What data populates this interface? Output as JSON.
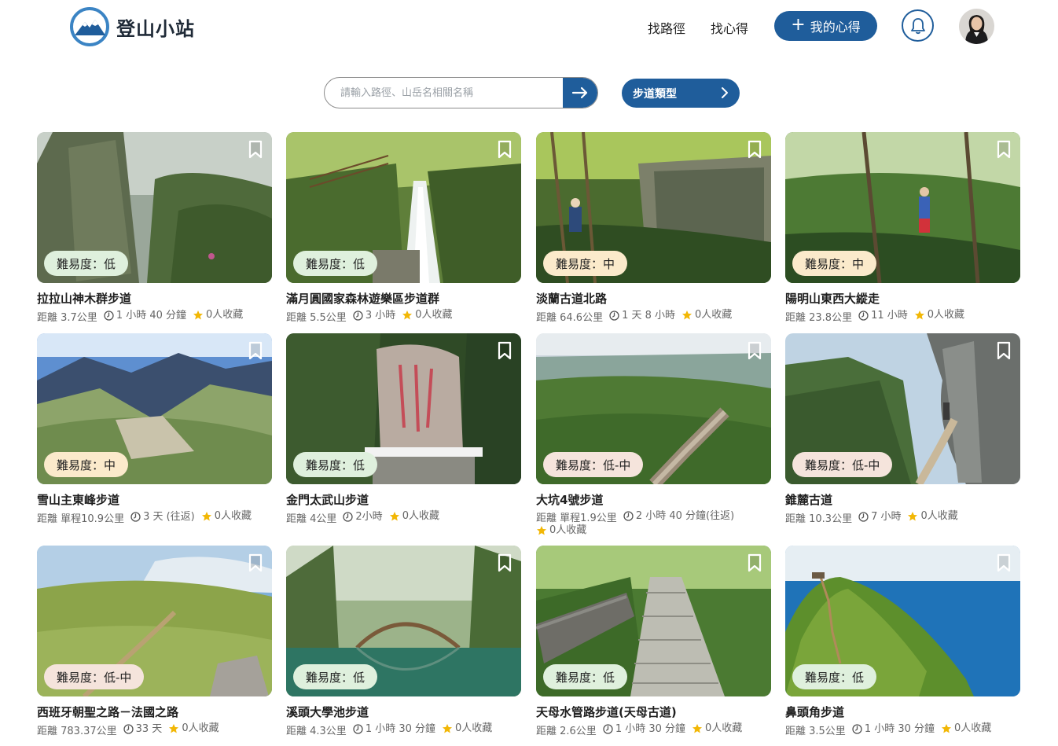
{
  "header": {
    "logo_text": "登山小站",
    "nav": [
      "找路徑",
      "找心得"
    ],
    "my_notes_label": "我的心得",
    "accent_color": "#1f5d9b"
  },
  "search": {
    "placeholder": "請輸入路徑、山岳名相關名稱",
    "value": "",
    "type_filter_label": "步道類型"
  },
  "icons": [
    "logo-mountain-icon",
    "plus-icon",
    "bell-icon",
    "avatar",
    "arrow-right-icon",
    "chevron-right-icon",
    "bookmark-icon",
    "clock-icon",
    "star-icon"
  ],
  "trails": [
    {
      "name": "拉拉山神木群步道",
      "difficulty": "難易度：低",
      "level": "low",
      "distance": "距離 3.7公里",
      "duration": "1 小時 40 分鐘",
      "favorites": "0人收藏"
    },
    {
      "name": "滿月圓國家森林遊樂區步道群",
      "difficulty": "難易度：低",
      "level": "low",
      "distance": "距離 5.5公里",
      "duration": "3 小時",
      "favorites": "0人收藏"
    },
    {
      "name": "淡蘭古道北路",
      "difficulty": "難易度：中",
      "level": "mid",
      "distance": "距離 64.6公里",
      "duration": "1 天 8 小時",
      "favorites": "0人收藏"
    },
    {
      "name": "陽明山東西大縱走",
      "difficulty": "難易度：中",
      "level": "mid",
      "distance": "距離 23.8公里",
      "duration": "11 小時",
      "favorites": "0人收藏"
    },
    {
      "name": "雪山主東峰步道",
      "difficulty": "難易度：中",
      "level": "mid",
      "distance": "距離 單程10.9公里",
      "duration": "3 天 (往返)",
      "favorites": "0人收藏"
    },
    {
      "name": "金門太武山步道",
      "difficulty": "難易度：低",
      "level": "low",
      "distance": "距離 4公里",
      "duration": "2小時",
      "favorites": "0人收藏"
    },
    {
      "name": "大坑4號步道",
      "difficulty": "難易度：低-中",
      "level": "lowmid",
      "distance": "距離 單程1.9公里",
      "duration": "2 小時 40 分鐘(往返)",
      "favorites": "0人收藏"
    },
    {
      "name": "錐麓古道",
      "difficulty": "難易度：低-中",
      "level": "lowmid",
      "distance": "距離 10.3公里",
      "duration": "7 小時",
      "favorites": "0人收藏"
    },
    {
      "name": "西班牙朝聖之路－法國之路",
      "difficulty": "難易度：低-中",
      "level": "lowmid",
      "distance": "距離 783.37公里",
      "duration": "33 天",
      "favorites": "0人收藏"
    },
    {
      "name": "溪頭大學池步道",
      "difficulty": "難易度：低",
      "level": "low",
      "distance": "距離 4.3公里",
      "duration": "1 小時 30 分鐘",
      "favorites": "0人收藏"
    },
    {
      "name": "天母水管路步道(天母古道)",
      "difficulty": "難易度：低",
      "level": "low",
      "distance": "距離 2.6公里",
      "duration": "1 小時 30 分鐘",
      "favorites": "0人收藏"
    },
    {
      "name": "鼻頭角步道",
      "difficulty": "難易度：低",
      "level": "low",
      "distance": "距離 3.5公里",
      "duration": "1 小時 30 分鐘",
      "favorites": "0人收藏"
    }
  ]
}
